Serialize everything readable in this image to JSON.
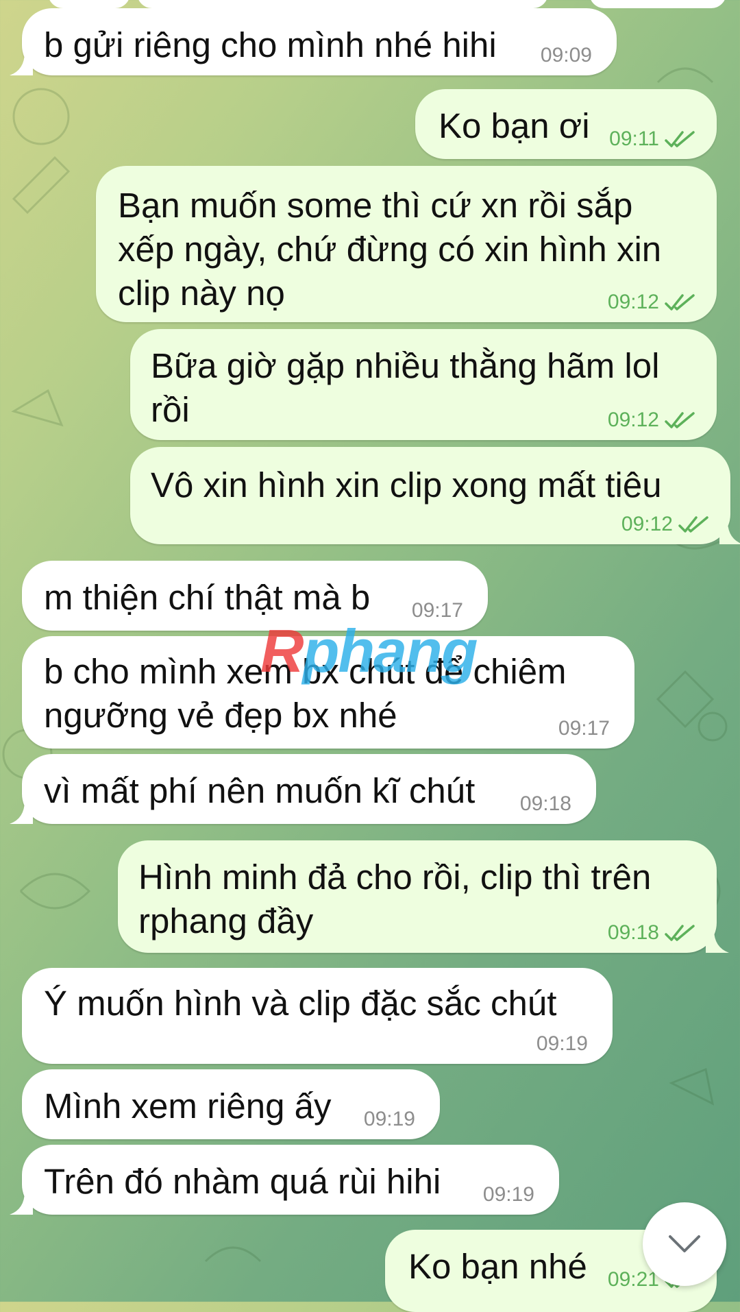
{
  "messages": [
    {
      "text": "b gửi riêng cho mình nhé hihi",
      "time": "09:09",
      "dir": "in"
    },
    {
      "text": "Ko bạn ơi",
      "time": "09:11",
      "dir": "out"
    },
    {
      "text": "Bạn muốn some thì cứ xn rồi sắp xếp ngày, chứ đừng có xin hình xin clip này nọ",
      "time": "09:12",
      "dir": "out"
    },
    {
      "text": "Bữa giờ gặp nhiều thằng hãm lol rồi",
      "time": "09:12",
      "dir": "out"
    },
    {
      "text": "Vô xin hình xin clip xong mất tiêu",
      "time": "09:12",
      "dir": "out"
    },
    {
      "text": "m thiện chí thật mà b",
      "time": "09:17",
      "dir": "in"
    },
    {
      "text": "b cho mình xem bx chút để chiêm ngưỡng vẻ đẹp bx nhé",
      "time": "09:17",
      "dir": "in"
    },
    {
      "text": "vì mất phí nên muốn kĩ chút",
      "time": "09:18",
      "dir": "in"
    },
    {
      "text": "Hình minh đả cho rồi, clip thì trên rphang đầy",
      "time": "09:18",
      "dir": "out"
    },
    {
      "text": "Ý muốn hình và clip đặc sắc chút",
      "time": "09:19",
      "dir": "in"
    },
    {
      "text": "Mình xem riêng ấy",
      "time": "09:19",
      "dir": "in"
    },
    {
      "text": "Trên đó nhàm quá rùi hihi",
      "time": "09:19",
      "dir": "in"
    },
    {
      "text": "Ko bạn nhé",
      "time": "09:21",
      "dir": "out"
    }
  ],
  "watermark": {
    "first": "R",
    "rest": "phang"
  },
  "scroll_button": {
    "icon": "chevron-down-icon"
  },
  "colors": {
    "incoming_bubble": "#ffffff",
    "outgoing_bubble": "#eefedf",
    "outgoing_time": "#5db15a",
    "incoming_time": "#8d8d8d",
    "watermark_red": "#ee3b3b",
    "watermark_blue": "#2db0ea"
  }
}
